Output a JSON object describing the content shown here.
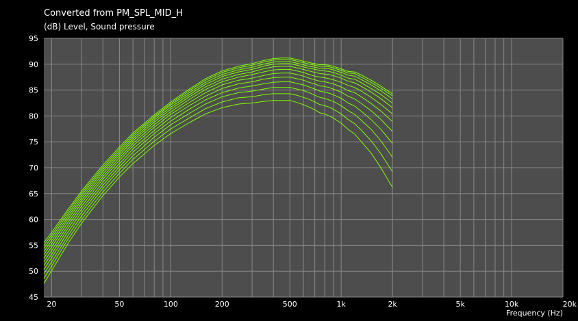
{
  "chart_data": {
    "type": "line",
    "title": "Converted from PM_SPL_MID_H",
    "ylabel": "(dB)  Level, Sound pressure",
    "xlabel": "Frequency  (Hz)",
    "x_scale": "log",
    "xlim": [
      18,
      20000
    ],
    "ylim": [
      45,
      95
    ],
    "grid": true,
    "x_ticks": [
      {
        "v": 20,
        "label": "20"
      },
      {
        "v": 50,
        "label": "50"
      },
      {
        "v": 100,
        "label": "100"
      },
      {
        "v": 200,
        "label": "200"
      },
      {
        "v": 500,
        "label": "500"
      },
      {
        "v": 1000,
        "label": "1k"
      },
      {
        "v": 2000,
        "label": "2k"
      },
      {
        "v": 5000,
        "label": "5k"
      },
      {
        "v": 10000,
        "label": "10k"
      },
      {
        "v": 20000,
        "label": "20k"
      }
    ],
    "y_ticks": [
      45,
      50,
      55,
      60,
      65,
      70,
      75,
      80,
      85,
      90,
      95
    ],
    "line_color": "#7fff00",
    "x": [
      18,
      20,
      25,
      30,
      40,
      50,
      60,
      80,
      100,
      130,
      160,
      200,
      250,
      300,
      350,
      400,
      450,
      500,
      550,
      600,
      650,
      700,
      750,
      800,
      850,
      900,
      1000,
      1100,
      1200,
      1300,
      1500,
      1700,
      2000
    ],
    "series": [
      {
        "values": [
          55.5,
          57.5,
          62.0,
          65.5,
          70.5,
          74.0,
          76.7,
          80.2,
          82.7,
          85.3,
          87.2,
          88.7,
          89.6,
          90.1,
          90.7,
          91.1,
          91.2,
          91.2,
          90.9,
          90.6,
          90.3,
          90.1,
          89.9,
          89.9,
          89.8,
          89.6,
          89.1,
          88.6,
          88.5,
          88.0,
          86.9,
          85.8,
          84.3
        ]
      },
      {
        "values": [
          55.0,
          57.0,
          61.6,
          65.1,
          70.1,
          73.6,
          76.4,
          79.9,
          82.4,
          85.0,
          86.9,
          88.4,
          89.3,
          89.8,
          90.4,
          90.8,
          90.9,
          90.9,
          90.6,
          90.3,
          90.0,
          89.8,
          89.6,
          89.6,
          89.5,
          89.3,
          88.8,
          88.3,
          88.2,
          87.6,
          86.5,
          85.4,
          83.9
        ]
      },
      {
        "values": [
          54.4,
          56.5,
          61.1,
          64.7,
          69.7,
          73.2,
          76.0,
          79.6,
          82.1,
          84.6,
          86.5,
          88.0,
          88.9,
          89.4,
          90.0,
          90.4,
          90.5,
          90.5,
          90.2,
          89.9,
          89.6,
          89.4,
          89.2,
          89.2,
          89.1,
          88.9,
          88.4,
          87.9,
          87.7,
          87.1,
          86.0,
          84.9,
          83.3
        ]
      },
      {
        "values": [
          53.8,
          55.9,
          60.6,
          64.2,
          69.3,
          72.8,
          75.6,
          79.2,
          81.7,
          84.2,
          86.1,
          87.6,
          88.5,
          89.0,
          89.6,
          90.0,
          90.1,
          90.1,
          89.8,
          89.5,
          89.2,
          89.0,
          88.8,
          88.7,
          88.6,
          88.4,
          87.9,
          87.3,
          87.1,
          86.5,
          85.3,
          84.2,
          82.5
        ]
      },
      {
        "values": [
          53.2,
          55.3,
          60.1,
          63.7,
          68.8,
          72.4,
          75.2,
          78.8,
          81.3,
          83.8,
          85.6,
          87.1,
          88.0,
          88.5,
          89.1,
          89.5,
          89.6,
          89.6,
          89.3,
          89.0,
          88.7,
          88.4,
          88.2,
          88.1,
          88.0,
          87.8,
          87.3,
          86.7,
          86.4,
          85.8,
          84.6,
          83.4,
          81.6
        ]
      },
      {
        "values": [
          52.5,
          54.7,
          59.5,
          63.2,
          68.3,
          71.9,
          74.7,
          78.3,
          80.8,
          83.3,
          85.1,
          86.6,
          87.5,
          88.0,
          88.5,
          88.9,
          89.0,
          89.0,
          88.7,
          88.4,
          88.0,
          87.7,
          87.5,
          87.4,
          87.2,
          87.0,
          86.5,
          85.9,
          85.5,
          84.9,
          83.6,
          82.3,
          80.4
        ]
      },
      {
        "values": [
          51.8,
          54.0,
          58.9,
          62.6,
          67.8,
          71.4,
          74.2,
          77.8,
          80.3,
          82.7,
          84.5,
          86.0,
          86.9,
          87.3,
          87.8,
          88.2,
          88.3,
          88.3,
          88.0,
          87.7,
          87.3,
          87.0,
          86.7,
          86.6,
          86.4,
          86.2,
          85.6,
          84.9,
          84.5,
          83.8,
          82.4,
          81.0,
          78.9
        ]
      },
      {
        "values": [
          51.1,
          53.3,
          58.3,
          62.0,
          67.2,
          70.8,
          73.6,
          77.2,
          79.7,
          82.1,
          83.8,
          85.3,
          86.2,
          86.6,
          87.1,
          87.4,
          87.5,
          87.5,
          87.2,
          86.9,
          86.5,
          86.2,
          85.8,
          85.7,
          85.5,
          85.2,
          84.6,
          83.8,
          83.3,
          82.5,
          81.0,
          79.4,
          77.0
        ]
      },
      {
        "values": [
          50.3,
          52.6,
          57.6,
          61.4,
          66.6,
          70.2,
          73.0,
          76.6,
          79.0,
          81.4,
          83.1,
          84.5,
          85.4,
          85.8,
          86.2,
          86.5,
          86.6,
          86.6,
          86.3,
          86.0,
          85.6,
          85.2,
          84.8,
          84.6,
          84.4,
          84.1,
          83.4,
          82.5,
          81.9,
          81.0,
          79.3,
          77.5,
          74.7
        ]
      },
      {
        "values": [
          49.5,
          51.8,
          56.9,
          60.7,
          66.0,
          69.6,
          72.3,
          75.9,
          78.3,
          80.6,
          82.3,
          83.7,
          84.5,
          84.8,
          85.2,
          85.5,
          85.5,
          85.5,
          85.2,
          84.9,
          84.5,
          84.0,
          83.6,
          83.4,
          83.1,
          82.8,
          82.0,
          81.0,
          80.3,
          79.3,
          77.4,
          75.3,
          72.0
        ]
      },
      {
        "values": [
          48.6,
          51.0,
          56.2,
          60.0,
          65.3,
          68.9,
          71.6,
          75.1,
          77.5,
          79.7,
          81.4,
          82.7,
          83.5,
          83.7,
          84.1,
          84.3,
          84.3,
          84.3,
          84.0,
          83.6,
          83.2,
          82.7,
          82.2,
          82.0,
          81.7,
          81.3,
          80.4,
          79.3,
          78.5,
          77.4,
          75.2,
          72.8,
          69.2
        ]
      },
      {
        "values": [
          47.6,
          50.1,
          55.4,
          59.3,
          64.6,
          68.2,
          70.8,
          74.3,
          76.6,
          78.8,
          80.4,
          81.6,
          82.3,
          82.5,
          82.8,
          83.0,
          83.0,
          83.0,
          82.6,
          82.2,
          81.7,
          81.2,
          80.6,
          80.4,
          80.0,
          79.6,
          78.6,
          77.4,
          76.5,
          75.2,
          72.8,
          70.1,
          66.2
        ]
      }
    ]
  }
}
